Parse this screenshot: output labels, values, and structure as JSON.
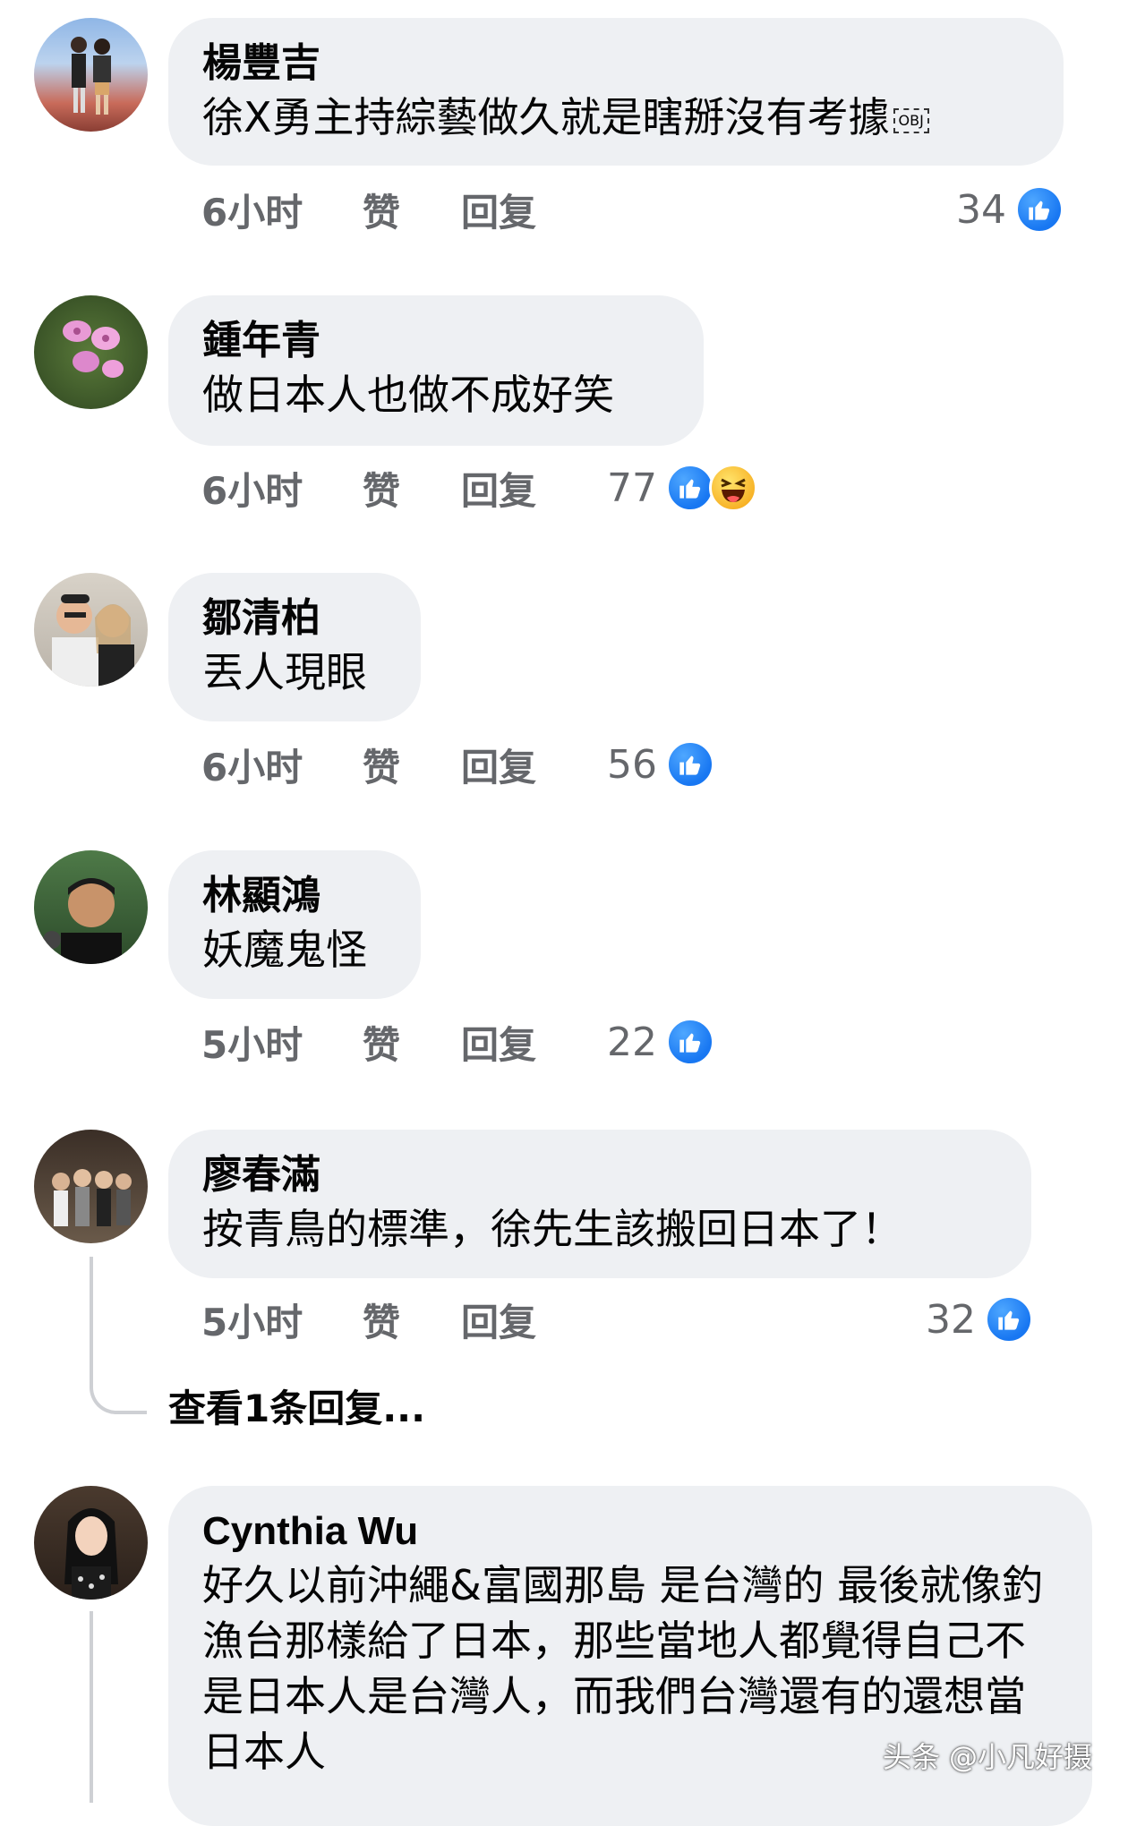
{
  "comments": [
    {
      "author": "楊豐吉",
      "text": "徐X勇主持綜藝做久就是瞎掰沒有考據",
      "obj": "OBJ",
      "time": "6小时",
      "like_label": "赞",
      "reply_label": "回复",
      "reactions": "34"
    },
    {
      "author": "鍾年青",
      "text": "做日本人也做不成好笑",
      "time": "6小时",
      "like_label": "赞",
      "reply_label": "回复",
      "reactions": "77"
    },
    {
      "author": "鄒清柏",
      "text": "丟人現眼",
      "time": "6小时",
      "like_label": "赞",
      "reply_label": "回复",
      "reactions": "56"
    },
    {
      "author": "林顯鴻",
      "text": "妖魔鬼怪",
      "time": "5小时",
      "like_label": "赞",
      "reply_label": "回复",
      "reactions": "22"
    },
    {
      "author": "廖春滿",
      "text": "按青鳥的標準，徐先生該搬回日本了！",
      "time": "5小时",
      "like_label": "赞",
      "reply_label": "回复",
      "reactions": "32",
      "view_replies": "查看1条回复..."
    },
    {
      "author": "Cynthia Wu",
      "text": "好久以前沖繩&富國那島 是台灣的 最後就像釣漁台那樣給了日本，那些當地人都覺得自己不是日本人是台灣人，而我們台灣還有的還想當日本人"
    }
  ],
  "watermark": "头条 @小凡好摄",
  "colors": {
    "bubble": "#eef0f3",
    "like_blue": "#1877f2",
    "meta_gray": "#65676b"
  },
  "icons": [
    "like-icon",
    "haha-icon"
  ]
}
